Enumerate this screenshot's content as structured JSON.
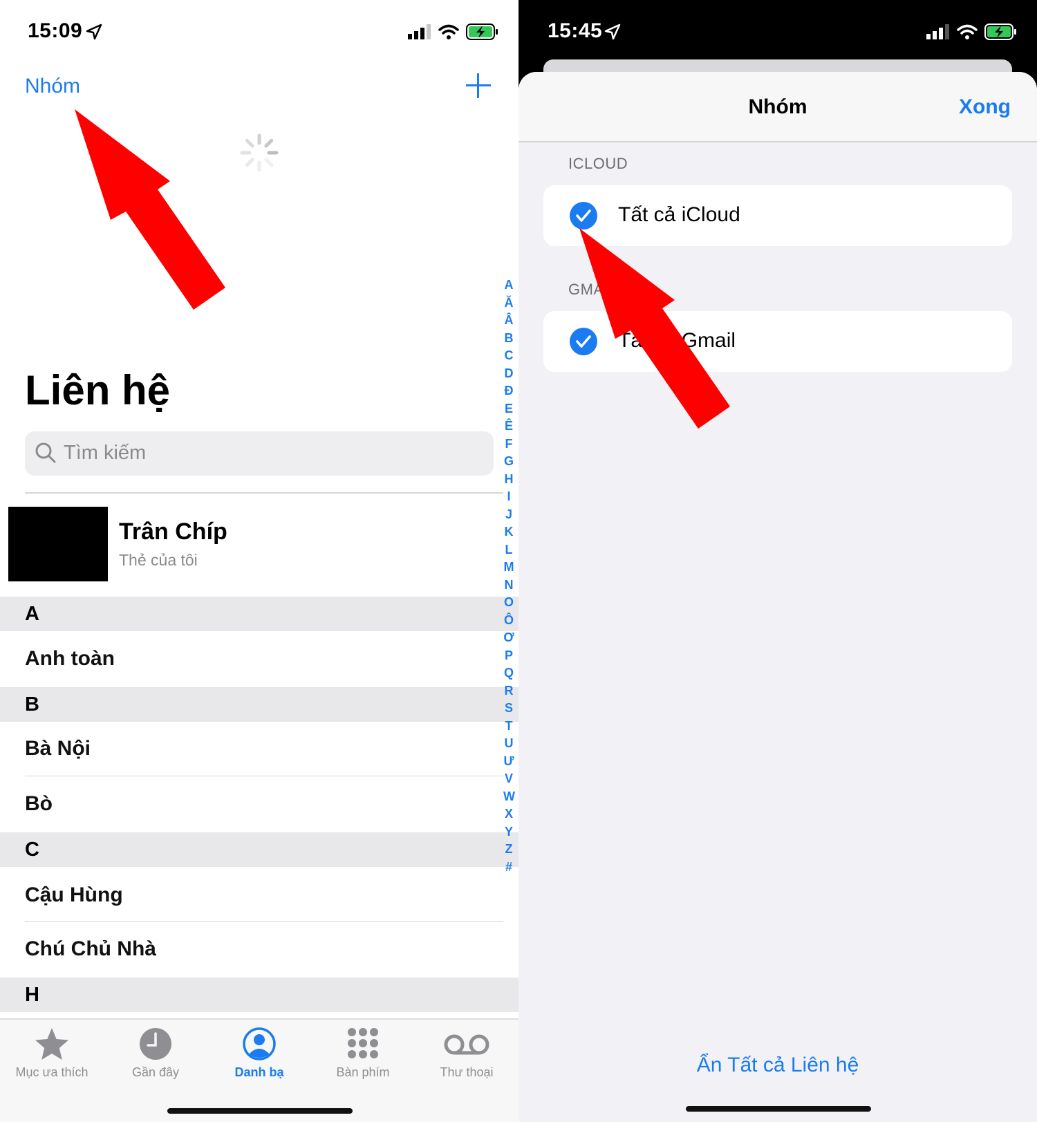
{
  "left": {
    "status": {
      "time": "15:09"
    },
    "nav": {
      "groups_label": "Nhóm"
    },
    "title": "Liên hệ",
    "search": {
      "placeholder": "Tìm kiếm"
    },
    "my_card": {
      "name": "Trân Chíp",
      "subtitle": "Thẻ của tôi"
    },
    "sections": [
      {
        "letter": "A",
        "contacts": [
          "Anh toàn"
        ]
      },
      {
        "letter": "B",
        "contacts": [
          "Bà Nội",
          "Bò"
        ]
      },
      {
        "letter": "C",
        "contacts": [
          "Cậu Hùng",
          "Chú Chủ Nhà"
        ]
      },
      {
        "letter": "H",
        "contacts": []
      }
    ],
    "index": [
      "A",
      "Ă",
      "Â",
      "B",
      "C",
      "D",
      "Đ",
      "E",
      "Ê",
      "F",
      "G",
      "H",
      "I",
      "J",
      "K",
      "L",
      "M",
      "N",
      "O",
      "Ô",
      "Ơ",
      "P",
      "Q",
      "R",
      "S",
      "T",
      "U",
      "Ư",
      "V",
      "W",
      "X",
      "Y",
      "Z",
      "#"
    ],
    "tabs": [
      {
        "label": "Mục ưa thích",
        "icon": "star-icon",
        "active": false
      },
      {
        "label": "Gần đây",
        "icon": "clock-icon",
        "active": false
      },
      {
        "label": "Danh bạ",
        "icon": "person-circle-icon",
        "active": true
      },
      {
        "label": "Bàn phím",
        "icon": "keypad-icon",
        "active": false
      },
      {
        "label": "Thư thoại",
        "icon": "voicemail-icon",
        "active": false
      }
    ]
  },
  "right": {
    "status": {
      "time": "15:45"
    },
    "sheet": {
      "title": "Nhóm",
      "done_label": "Xong",
      "groups": [
        {
          "header": "ICLOUD",
          "row_label": "Tất cả iCloud",
          "checked": true
        },
        {
          "header": "GMAIL",
          "row_label": "Tất cả Gmail",
          "checked": true
        }
      ],
      "hide_all_label": "Ẩn Tất cả Liên hệ"
    }
  },
  "colors": {
    "accent": "#1a7cf0",
    "arrow": "#ff0000",
    "battery": "#34c759"
  }
}
